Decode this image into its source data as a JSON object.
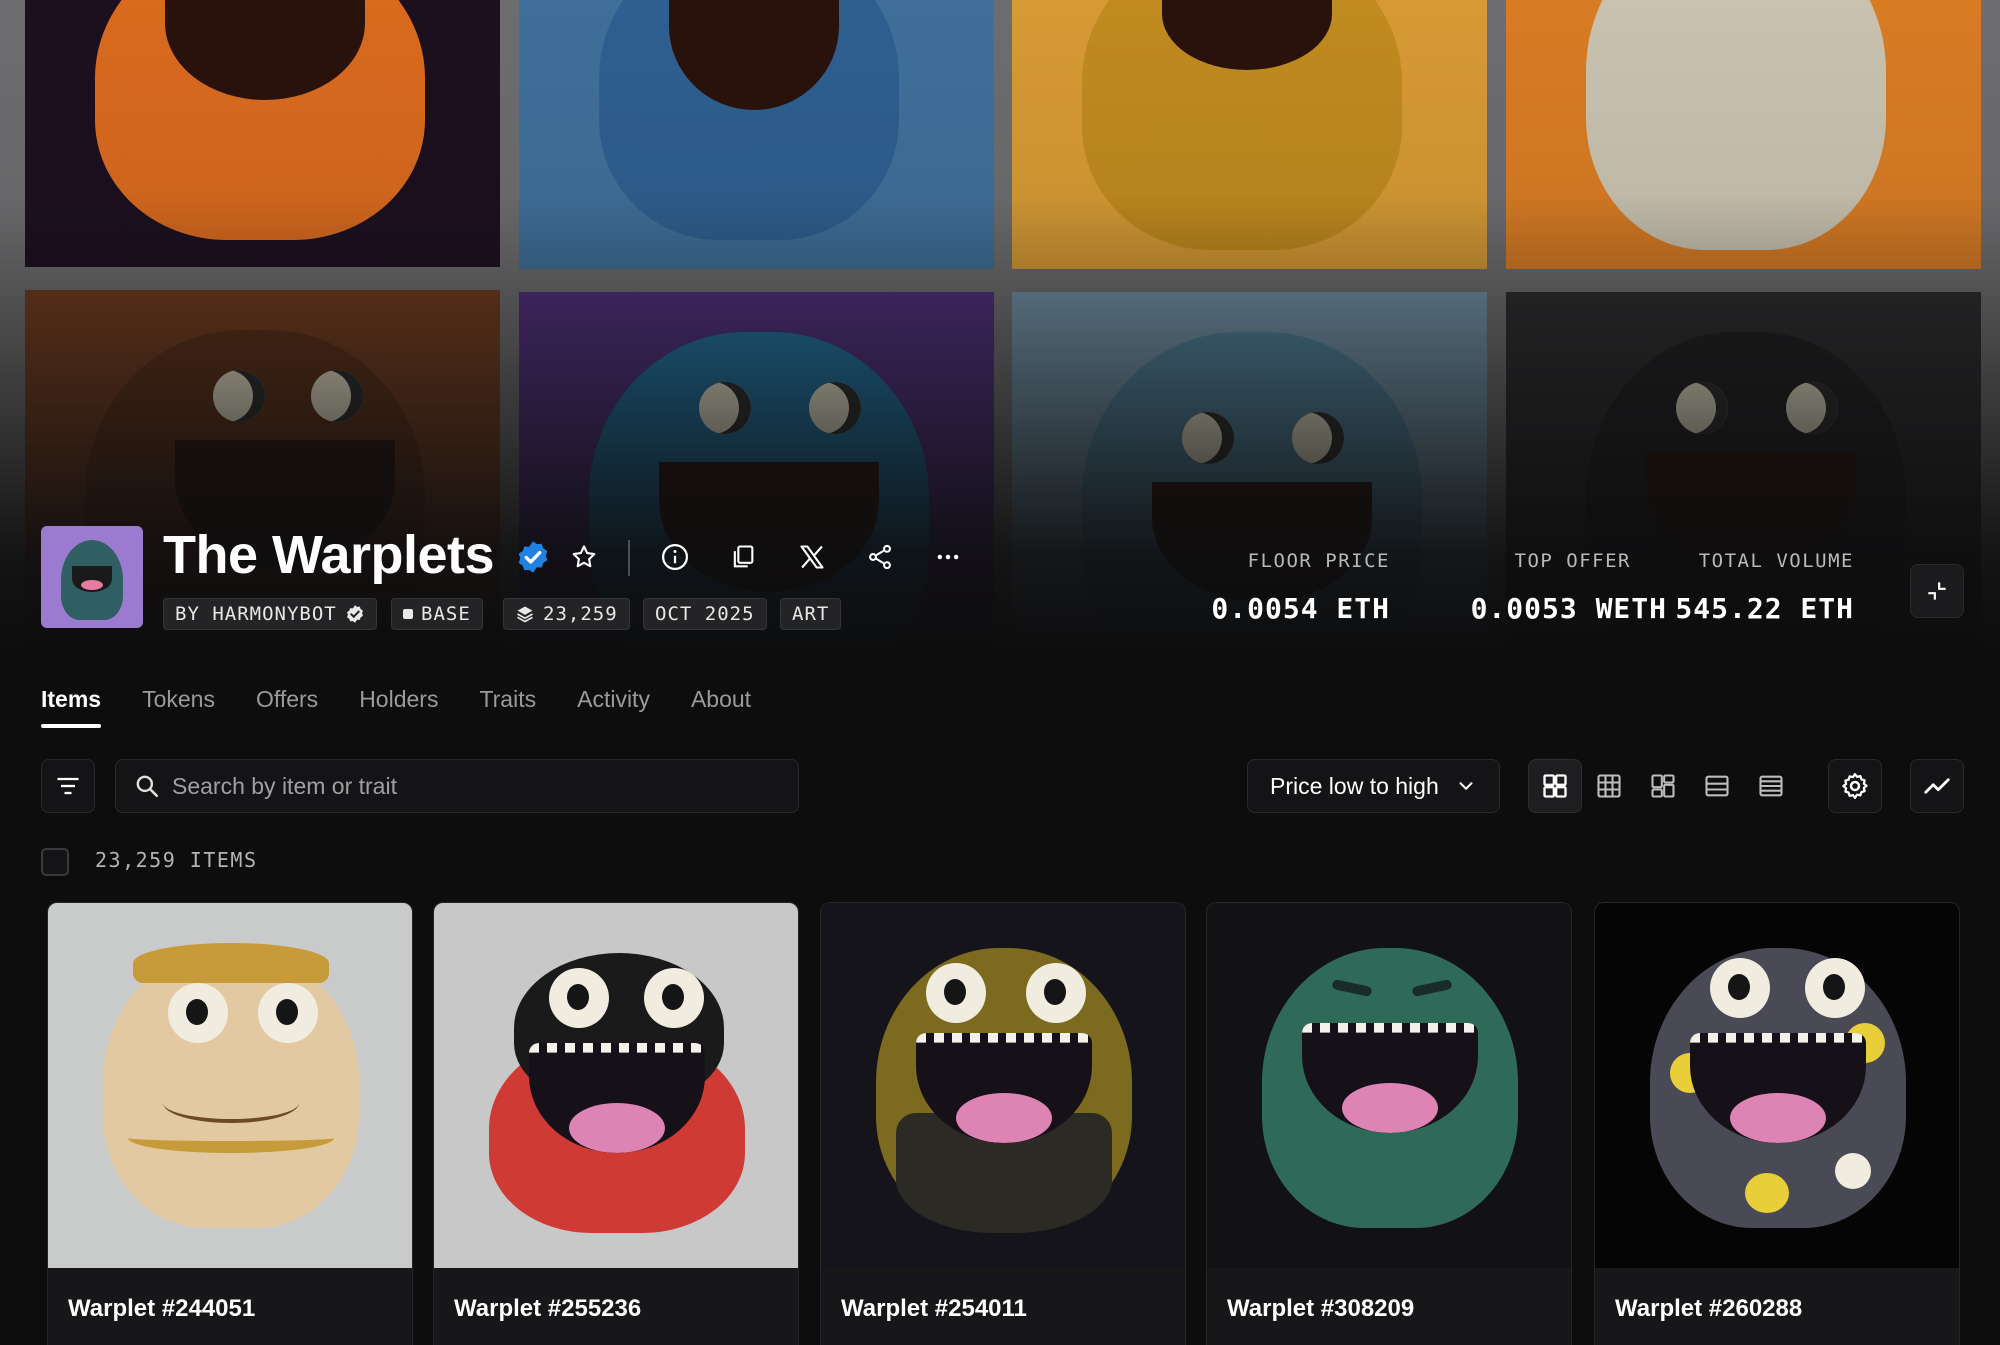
{
  "collection": {
    "title": "The Warplets",
    "chips": {
      "creator": "BY HARMONYBOT",
      "chain": "BASE",
      "supply": "23,259",
      "date": "OCT 2025",
      "category": "ART"
    }
  },
  "stats": [
    {
      "label": "FLOOR PRICE",
      "value": "0.0054 ETH"
    },
    {
      "label": "TOP OFFER",
      "value": "0.0053 WETH"
    },
    {
      "label": "TOTAL VOLUME",
      "value": "545.22 ETH"
    }
  ],
  "tabs": [
    "Items",
    "Tokens",
    "Offers",
    "Holders",
    "Traits",
    "Activity",
    "About"
  ],
  "search": {
    "placeholder": "Search by item or trait"
  },
  "sort": {
    "selected": "Price low to high"
  },
  "items_count": "23,259 ITEMS",
  "items": [
    {
      "name": "Warplet #244051"
    },
    {
      "name": "Warplet #255236"
    },
    {
      "name": "Warplet #254011"
    },
    {
      "name": "Warplet #308209"
    },
    {
      "name": "Warplet #260288"
    }
  ],
  "colors": {
    "background": "#0d0d0e",
    "verified": "#2081e2",
    "avatar_bg": "#9b7bd0"
  },
  "icons": [
    "star-icon",
    "info-icon",
    "copy-icon",
    "x-icon",
    "share-icon",
    "more-icon",
    "filter-icon",
    "search-icon",
    "chevron-down-icon",
    "gear-icon",
    "chart-icon",
    "collapse-icon"
  ]
}
